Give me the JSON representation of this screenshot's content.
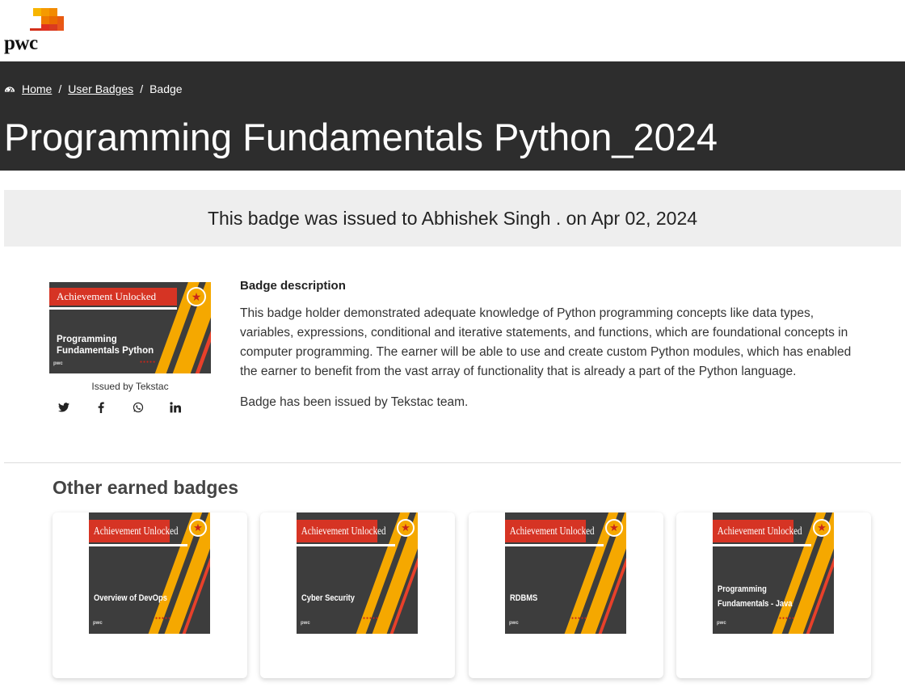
{
  "header": {
    "logo_text": "pwc"
  },
  "breadcrumb": {
    "home": "Home",
    "user_badges": "User Badges",
    "current": "Badge",
    "separator": "/"
  },
  "page_title": "Programming Fundamentals Python_2024",
  "issued_banner": "This badge was issued to Abhishek Singh . on Apr 02, 2024",
  "badge": {
    "ribbon": "Achievement Unlocked",
    "name": "Programming Fundamentals Python",
    "issued_by": "Issued by Tekstac",
    "mini_logo": "pwc",
    "dots": "●●●●●"
  },
  "social": {
    "twitter": "🐦",
    "facebook": "f",
    "whatsapp": "✆",
    "linkedin": "in"
  },
  "description": {
    "heading": "Badge description",
    "body": "This badge holder demonstrated adequate knowledge of Python programming concepts like data types, variables, expressions, conditional and iterative statements, and functions, which are foundational concepts in computer programming. The earner will be able to use and create custom Python modules, which has enabled the earner to benefit from the vast array of functionality that is already a part of the Python language.",
    "issued_note": "Badge has been issued by Tekstac team."
  },
  "other_badges": {
    "title": "Other earned badges",
    "items": [
      {
        "ribbon": "Achievement Unlocked",
        "name": "Overview of DevOps",
        "mini_logo": "pwc",
        "dots": "●●●●●"
      },
      {
        "ribbon": "Achievement Unlocked",
        "name": "Cyber Security",
        "mini_logo": "pwc",
        "dots": "●●●●●"
      },
      {
        "ribbon": "Achievement Unlocked",
        "name": "RDBMS",
        "mini_logo": "pwc",
        "dots": "●●●●●"
      },
      {
        "ribbon": "Achievement Unlocked",
        "name": "Programming Fundamentals - Java",
        "mini_logo": "pwc",
        "dots": "●●●●●"
      }
    ]
  },
  "colors": {
    "hero_bg": "#2d2d2d",
    "badge_bg": "#3d3d3d",
    "accent_yellow": "#f5a800",
    "accent_red": "#d63424"
  }
}
